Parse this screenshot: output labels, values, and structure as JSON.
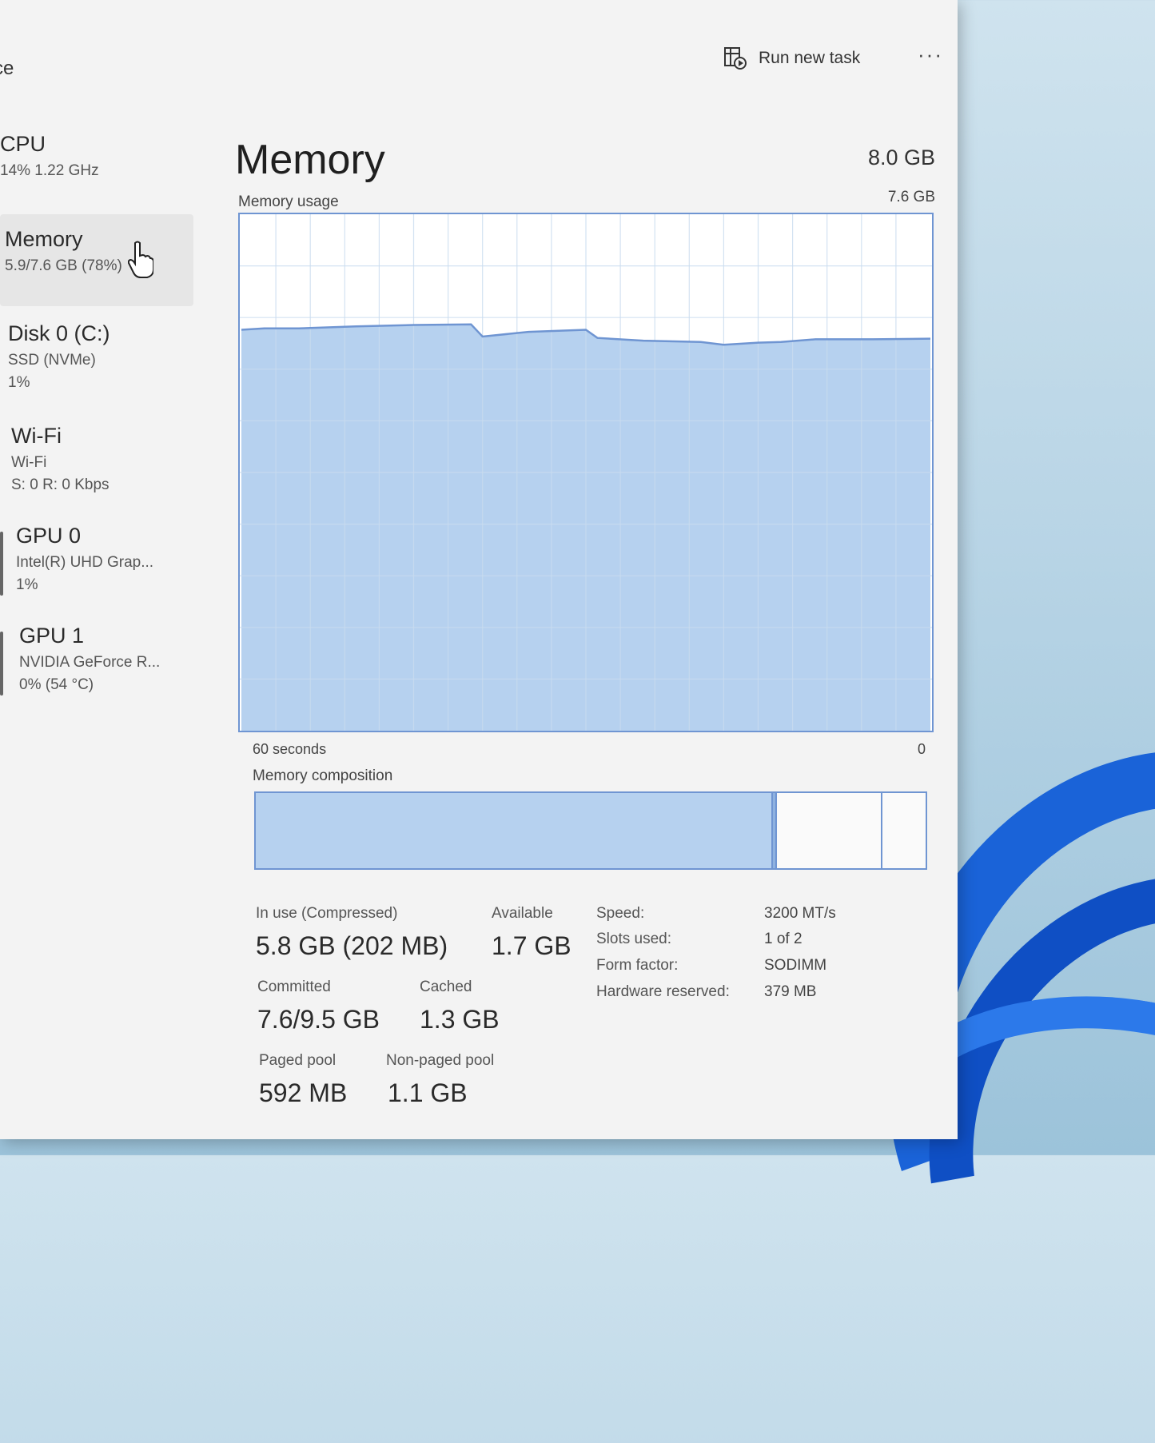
{
  "window": {
    "page_crumb": "ce",
    "run_new_task": "Run new task",
    "more": "···"
  },
  "sidebar": {
    "items": [
      {
        "name": "CPU",
        "lines": [
          "14%  1.22 GHz"
        ]
      },
      {
        "name": "Memory",
        "lines": [
          "5.9/7.6 GB (78%)"
        ],
        "active": true
      },
      {
        "name": "Disk 0 (C:)",
        "lines": [
          "SSD (NVMe)",
          "1%"
        ]
      },
      {
        "name": "Wi-Fi",
        "lines": [
          "Wi-Fi",
          "S: 0 R: 0 Kbps"
        ]
      },
      {
        "name": "GPU 0",
        "lines": [
          "Intel(R) UHD Grap...",
          "1%"
        ]
      },
      {
        "name": "GPU 1",
        "lines": [
          "NVIDIA GeForce R...",
          "0%  (54 °C)"
        ]
      }
    ]
  },
  "memory": {
    "title": "Memory",
    "total": "8.0 GB",
    "usage_label": "Memory usage",
    "max_label": "7.6 GB",
    "axis_left": "60 seconds",
    "axis_right": "0",
    "composition_label": "Memory composition",
    "composition": {
      "in_use_fraction": 0.77,
      "modified_fraction": 0.006,
      "standby_fraction": 0.157,
      "free_fraction": 0.067
    },
    "stats": {
      "in_use_label": "In use (Compressed)",
      "in_use_value": "5.8 GB (202 MB)",
      "available_label": "Available",
      "available_value": "1.7 GB",
      "committed_label": "Committed",
      "committed_value": "7.6/9.5 GB",
      "cached_label": "Cached",
      "cached_value": "1.3 GB",
      "paged_pool_label": "Paged pool",
      "paged_pool_value": "592 MB",
      "nonpaged_pool_label": "Non-paged pool",
      "nonpaged_pool_value": "1.1 GB"
    },
    "specs": {
      "speed_label": "Speed:",
      "speed_value": "3200 MT/s",
      "slots_label": "Slots used:",
      "slots_value": "1 of 2",
      "form_label": "Form factor:",
      "form_value": "SODIMM",
      "hw_label": "Hardware reserved:",
      "hw_value": "379 MB"
    }
  },
  "chart_data": {
    "type": "area",
    "title": "",
    "xlabel": "",
    "ylabel": "",
    "xlim": [
      60,
      0
    ],
    "ylim": [
      0,
      7.6
    ],
    "x": [
      60,
      58,
      55,
      50,
      45,
      40,
      39,
      35,
      30,
      29,
      25,
      20,
      18,
      15,
      13,
      10,
      5,
      0
    ],
    "series": [
      {
        "name": "",
        "values": [
          5.9,
          5.92,
          5.92,
          5.95,
          5.97,
          5.98,
          5.8,
          5.87,
          5.9,
          5.78,
          5.74,
          5.72,
          5.68,
          5.71,
          5.72,
          5.76,
          5.76,
          5.77
        ]
      }
    ],
    "grid": true,
    "colors": {
      "fill": "#b6d1ef",
      "line": "#6f95d2",
      "grid": "#c9dcef"
    }
  }
}
